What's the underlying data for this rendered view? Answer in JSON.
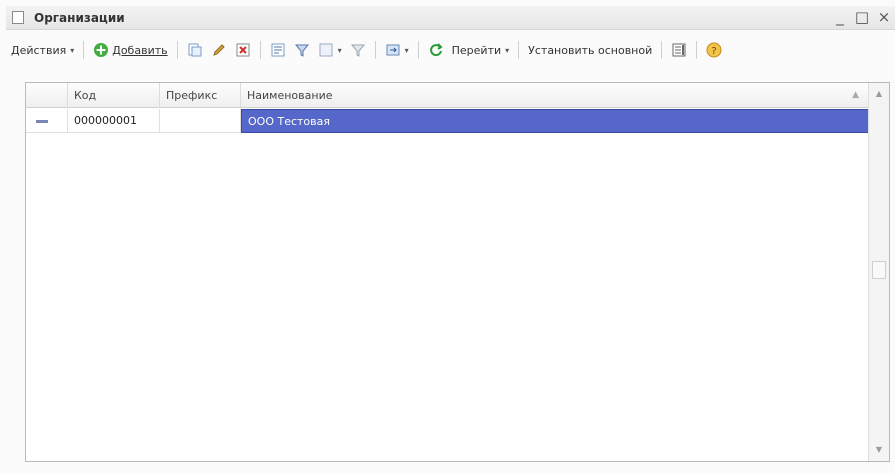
{
  "window": {
    "title": "Организации",
    "controls": {
      "minimize": "_",
      "maximize": "□",
      "close": "×"
    }
  },
  "toolbar": {
    "actions_label": "Действия",
    "add_label": "Добавить",
    "goto_label": "Перейти",
    "set_main_label": "Установить основной"
  },
  "grid": {
    "columns": [
      "Код",
      "Префикс",
      "Наименование"
    ],
    "rows": [
      {
        "code": "000000001",
        "prefix": "",
        "name": "ООО Тестовая"
      }
    ]
  },
  "colors": {
    "selection": "#5567c8",
    "add_icon": "#3fae3f",
    "help_icon": "#e6a020"
  }
}
